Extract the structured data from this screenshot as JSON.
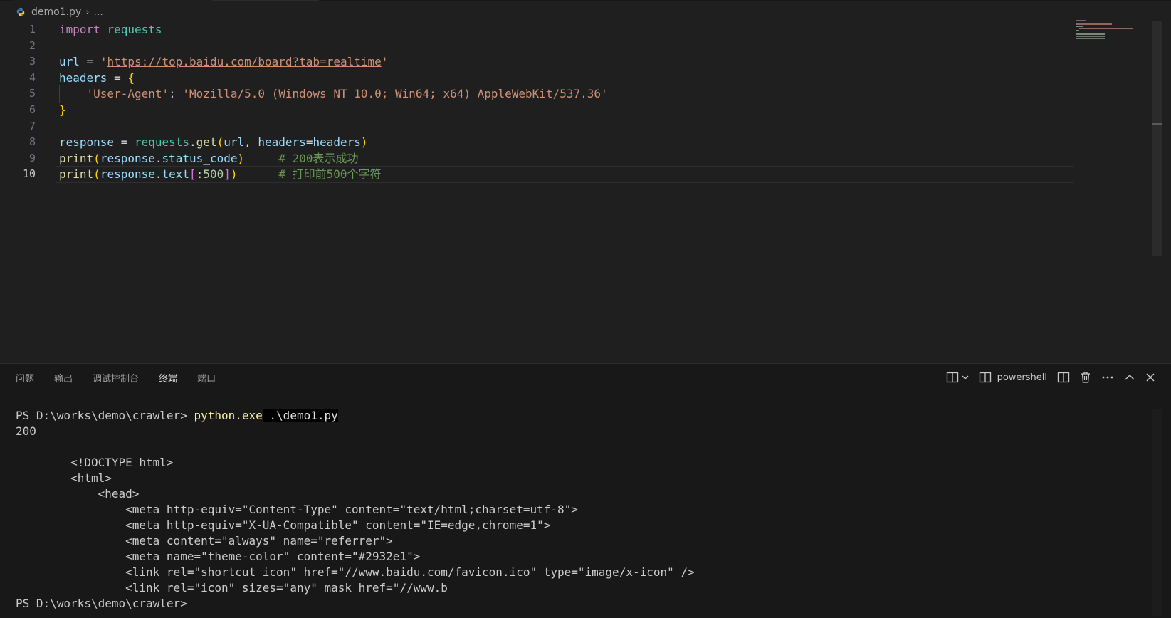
{
  "breadcrumb": {
    "file": "demo1.py",
    "more": "...",
    "python_color": "#3e7bb8",
    "python_color_2": "#f2c94c"
  },
  "editor": {
    "lines": [
      {
        "num": "1",
        "tokens": [
          {
            "t": "import",
            "c": "kw-import"
          },
          {
            "t": " ",
            "c": "plain"
          },
          {
            "t": "requests",
            "c": "mod"
          }
        ]
      },
      {
        "num": "2",
        "tokens": []
      },
      {
        "num": "3",
        "tokens": [
          {
            "t": "url",
            "c": "var"
          },
          {
            "t": " = ",
            "c": "op"
          },
          {
            "t": "'",
            "c": "str"
          },
          {
            "t": "https://top.baidu.com/board?tab=realtime",
            "c": "str-url"
          },
          {
            "t": "'",
            "c": "str"
          }
        ]
      },
      {
        "num": "4",
        "tokens": [
          {
            "t": "headers",
            "c": "var"
          },
          {
            "t": " = ",
            "c": "op"
          },
          {
            "t": "{",
            "c": "br1"
          }
        ]
      },
      {
        "num": "5",
        "guide": true,
        "tokens": [
          {
            "t": "    ",
            "c": "plain"
          },
          {
            "t": "'User-Agent'",
            "c": "str"
          },
          {
            "t": ": ",
            "c": "op"
          },
          {
            "t": "'Mozilla/5.0 (Windows NT 10.0; Win64; x64) AppleWebKit/537.36'",
            "c": "str"
          }
        ]
      },
      {
        "num": "6",
        "tokens": [
          {
            "t": "}",
            "c": "br1"
          }
        ]
      },
      {
        "num": "7",
        "tokens": []
      },
      {
        "num": "8",
        "tokens": [
          {
            "t": "response",
            "c": "var"
          },
          {
            "t": " = ",
            "c": "op"
          },
          {
            "t": "requests",
            "c": "mod"
          },
          {
            "t": ".",
            "c": "op"
          },
          {
            "t": "get",
            "c": "fn"
          },
          {
            "t": "(",
            "c": "br1"
          },
          {
            "t": "url",
            "c": "var"
          },
          {
            "t": ", ",
            "c": "op"
          },
          {
            "t": "headers",
            "c": "var"
          },
          {
            "t": "=",
            "c": "op"
          },
          {
            "t": "headers",
            "c": "var"
          },
          {
            "t": ")",
            "c": "br1"
          }
        ]
      },
      {
        "num": "9",
        "tokens": [
          {
            "t": "print",
            "c": "fn"
          },
          {
            "t": "(",
            "c": "br1"
          },
          {
            "t": "response",
            "c": "var"
          },
          {
            "t": ".",
            "c": "op"
          },
          {
            "t": "status_code",
            "c": "var"
          },
          {
            "t": ")",
            "c": "br1"
          },
          {
            "t": "     ",
            "c": "plain"
          },
          {
            "t": "# 200表示成功",
            "c": "cmt"
          }
        ]
      },
      {
        "num": "10",
        "current": true,
        "tokens": [
          {
            "t": "print",
            "c": "fn"
          },
          {
            "t": "(",
            "c": "br1"
          },
          {
            "t": "response",
            "c": "var"
          },
          {
            "t": ".",
            "c": "op"
          },
          {
            "t": "text",
            "c": "var"
          },
          {
            "t": "[",
            "c": "br2"
          },
          {
            "t": ":",
            "c": "op"
          },
          {
            "t": "500",
            "c": "num"
          },
          {
            "t": "]",
            "c": "br2"
          },
          {
            "t": ")",
            "c": "br1"
          },
          {
            "t": "      ",
            "c": "plain"
          },
          {
            "t": "# 打印前500个字符",
            "c": "cmt"
          }
        ]
      }
    ]
  },
  "panel": {
    "tabs": [
      {
        "label": "问题",
        "active": false
      },
      {
        "label": "输出",
        "active": false
      },
      {
        "label": "调试控制台",
        "active": false
      },
      {
        "label": "终端",
        "active": true
      },
      {
        "label": "端口",
        "active": false
      }
    ],
    "terminal_name": "powershell",
    "accent": "#0078d4"
  },
  "terminal": {
    "prompt1": "PS D:\\works\\demo\\crawler> ",
    "cmd": "python.exe",
    "arg": " .\\demo1.py",
    "output": [
      "200",
      "",
      "        <!DOCTYPE html>",
      "        <html>",
      "            <head>",
      "                <meta http-equiv=\"Content-Type\" content=\"text/html;charset=utf-8\">",
      "                <meta http-equiv=\"X-UA-Compatible\" content=\"IE=edge,chrome=1\">",
      "                <meta content=\"always\" name=\"referrer\">",
      "                <meta name=\"theme-color\" content=\"#2932e1\">",
      "                <link rel=\"shortcut icon\" href=\"//www.baidu.com/favicon.ico\" type=\"image/x-icon\" />",
      "                <link rel=\"icon\" sizes=\"any\" mask href=\"//www.b"
    ],
    "prompt2": "PS D:\\works\\demo\\crawler> "
  }
}
